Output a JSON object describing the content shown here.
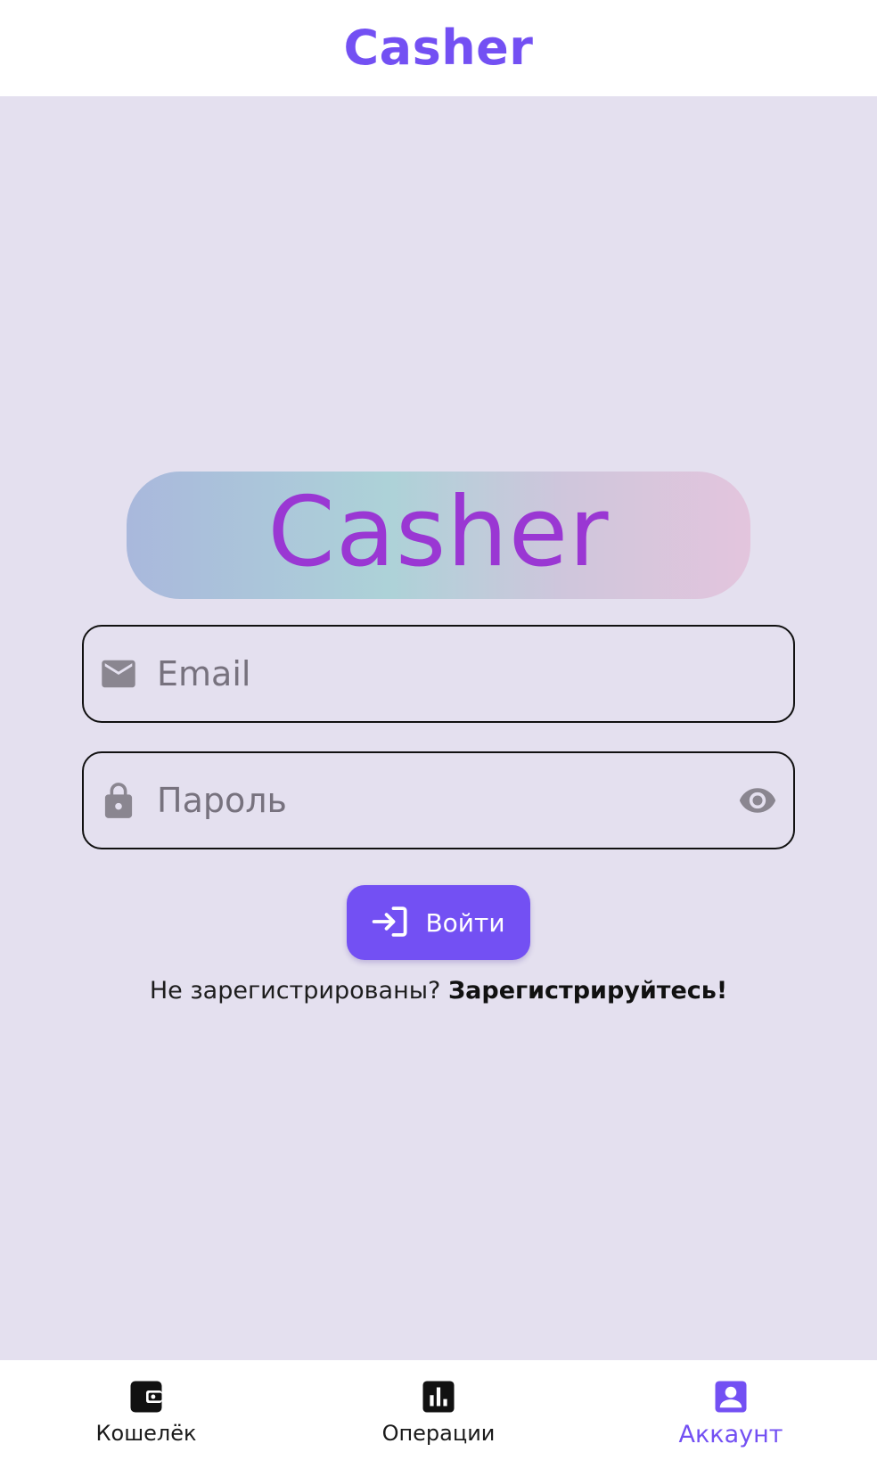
{
  "app_bar": {
    "title": "Casher"
  },
  "logo": {
    "text": "Casher"
  },
  "form": {
    "email_placeholder": "Email",
    "email_value": "",
    "password_placeholder": "Пароль",
    "password_value": "",
    "login_label": "Войти"
  },
  "register": {
    "prompt": "Не зарегистрированы?",
    "link": "Зарегистрируйтесь!"
  },
  "bottom_nav": {
    "items": [
      {
        "label": "Кошелёк",
        "icon": "wallet-icon",
        "active": false
      },
      {
        "label": "Операции",
        "icon": "bar-chart-icon",
        "active": false
      },
      {
        "label": "Аккаунт",
        "icon": "account-box-icon",
        "active": true
      }
    ]
  },
  "colors": {
    "accent": "#7350f3",
    "logo_text": "#9a37d3",
    "background": "#e4e0ef",
    "icon_gray": "#8a8690"
  }
}
